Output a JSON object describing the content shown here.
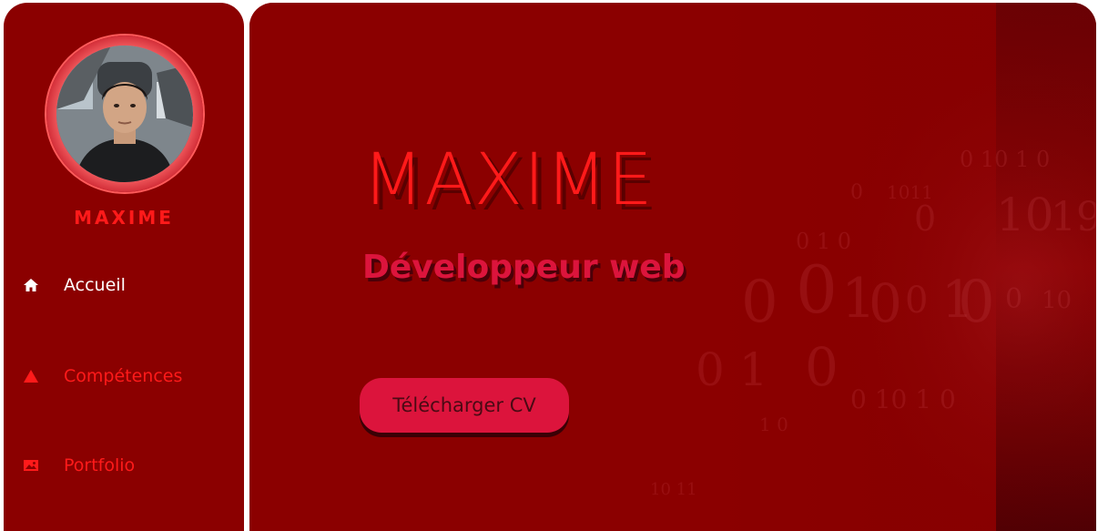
{
  "sidebar": {
    "brand_name": "MAXIME",
    "avatar_alt": "",
    "nav": [
      {
        "label": "Accueil",
        "icon": "home-icon",
        "active": true
      },
      {
        "label": "Compétences",
        "icon": "warning-triangle-icon",
        "active": false
      },
      {
        "label": "Portfolio",
        "icon": "image-icon",
        "active": false
      }
    ]
  },
  "hero": {
    "title": "MAXIME",
    "subtitle": "Développeur web",
    "cv_button_label": "Télécharger CV"
  },
  "colors": {
    "background": "#8b0000",
    "accent": "#ff1a1a",
    "button": "#dc143c"
  }
}
